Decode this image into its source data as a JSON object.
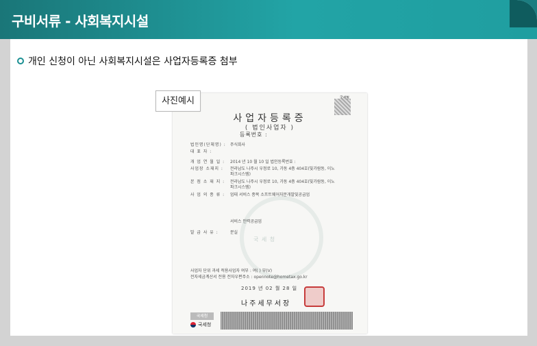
{
  "header": {
    "title": "구비서류 - 사회복지시설"
  },
  "notice": {
    "text": "개인 신청이 아닌 사회복지시설은 사업자등록증 첨부"
  },
  "photo": {
    "label": "사진예시"
  },
  "document": {
    "corner_mark": "국세청",
    "title": "사업자등록증",
    "subtitle": "( 법인사업자 )",
    "reg_no_label": "등록번호 :",
    "rows": [
      {
        "label": "법인명(단체명) :",
        "value": "주식회사"
      },
      {
        "label": "대 표 자 :",
        "value": ""
      },
      {
        "label": "개 업 연 월 일 :",
        "value": "2014 년 10 월 10 일   법인등록번호 :"
      },
      {
        "label": "사업장 소재지 :",
        "value": "전라남도 나주시 우정로 10, 가동 4층 404호(빛가람동, 이노"
      },
      {
        "label": "",
        "value": "파크시스템)"
      },
      {
        "label": "본 점 소 재 지 :",
        "value": "전라남도 나주시 우정로 10, 가동 4층 404호(빛가람동, 이노"
      },
      {
        "label": "",
        "value": "파크시스템)"
      },
      {
        "label": "사 업 의 종 류 :",
        "value": "업태 서비스          종목 소프트웨어자문개발및공급업"
      },
      {
        "label": "",
        "value": "서비스              인력공급업"
      },
      {
        "label": "발 급 사 유 :",
        "value": "분실"
      },
      {
        "label": "사업자 단위 과세 적용사업자 여부 :",
        "value": "여(  ) 부(V)"
      },
      {
        "label": "전자세금계산서 전용 전자우편주소 :",
        "value": "opennote@hometax.go.kr"
      }
    ],
    "issue_date": "2019 년 02 월 28 일",
    "office": "나주세무서장",
    "seal_text": "국 세 청",
    "footer_box": "국세청",
    "footer_logo": "국세청"
  },
  "colors": {
    "header_start": "#1a7678",
    "header_mid": "#22a4a6",
    "panel_bg": "#ffffff",
    "frame_bg": "#d3d3d3",
    "bullet": "#1a8f92"
  }
}
